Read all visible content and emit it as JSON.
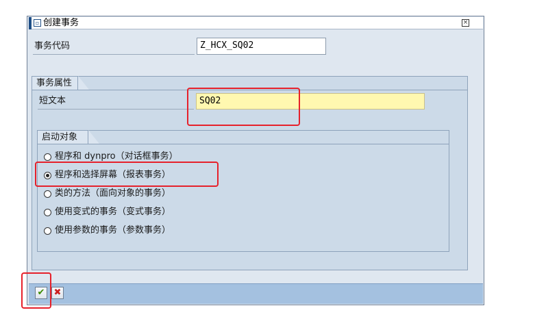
{
  "dialog": {
    "title": "创建事务",
    "title_icon": "create-transaction-icon",
    "close_icon": "close-icon"
  },
  "tcode": {
    "label": "事务代码",
    "value": "Z_HCX_SQ02"
  },
  "attributes": {
    "group_title": "事务属性",
    "short_text_label": "短文本",
    "short_text_value": "SQ02"
  },
  "start_object": {
    "group_title": "启动对象",
    "options": [
      {
        "label": "程序和 dynpro（对话框事务）",
        "selected": false
      },
      {
        "label": "程序和选择屏幕（报表事务）",
        "selected": true
      },
      {
        "label": "类的方法（面向对象的事务）",
        "selected": false
      },
      {
        "label": "使用变式的事务（变式事务）",
        "selected": false
      },
      {
        "label": "使用参数的事务（参数事务）",
        "selected": false
      }
    ]
  },
  "toolbar": {
    "ok_icon": "checkmark-icon",
    "cancel_icon": "cancel-x-icon"
  },
  "colors": {
    "dialog_bg": "#dfe7f0",
    "group_bg": "#ccdae8",
    "required_field": "#fff8b0",
    "toolbar_bg": "#a4c1e0",
    "annotation": "#e6202a"
  }
}
